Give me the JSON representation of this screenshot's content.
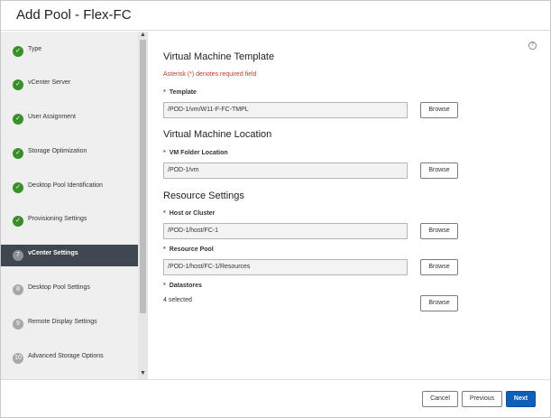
{
  "dialog": {
    "title": "Add Pool - Flex-FC"
  },
  "sidebar": {
    "steps": [
      {
        "label": "Type",
        "badge": "✓",
        "state": "done"
      },
      {
        "label": "vCenter Server",
        "badge": "✓",
        "state": "done"
      },
      {
        "label": "User Assignment",
        "badge": "✓",
        "state": "done"
      },
      {
        "label": "Storage Optimization",
        "badge": "✓",
        "state": "done"
      },
      {
        "label": "Desktop Pool Identification",
        "badge": "✓",
        "state": "done"
      },
      {
        "label": "Provisioning Settings",
        "badge": "✓",
        "state": "done"
      },
      {
        "label": "vCenter Settings",
        "badge": "7",
        "state": "current"
      },
      {
        "label": "Desktop Pool Settings",
        "badge": "8",
        "state": "todo"
      },
      {
        "label": "Remote Display Settings",
        "badge": "9",
        "state": "todo"
      },
      {
        "label": "Advanced Storage Options",
        "badge": "10",
        "state": "todo"
      }
    ],
    "scroll_up_glyph": "▲",
    "scroll_down_glyph": "▼"
  },
  "help_glyph": "?",
  "vm_template": {
    "heading": "Virtual Machine Template",
    "required_note": "Asterisk (*) denotes required field",
    "template_label": "Template",
    "template_value": "/POD-1/vm/W11-F-FC-TMPL"
  },
  "vm_location": {
    "heading": "Virtual Machine Location",
    "folder_label": "VM Folder Location",
    "folder_value": "/POD-1/vm"
  },
  "resource_settings": {
    "heading": "Resource Settings",
    "host_label": "Host or Cluster",
    "host_value": "/POD-1/host/FC-1",
    "pool_label": "Resource Pool",
    "pool_value": "/POD-1/host/FC-1/Resources",
    "datastores_label": "Datastores",
    "datastores_value": "4 selected"
  },
  "required_star": "*",
  "browse_label": "Browse",
  "footer": {
    "cancel_label": "Cancel",
    "previous_label": "Previous",
    "next_label": "Next"
  },
  "colors": {
    "done": "#3a8f2a",
    "active_bg": "#3f4750",
    "primary": "#0d5fb8",
    "required": "#c0392b"
  }
}
